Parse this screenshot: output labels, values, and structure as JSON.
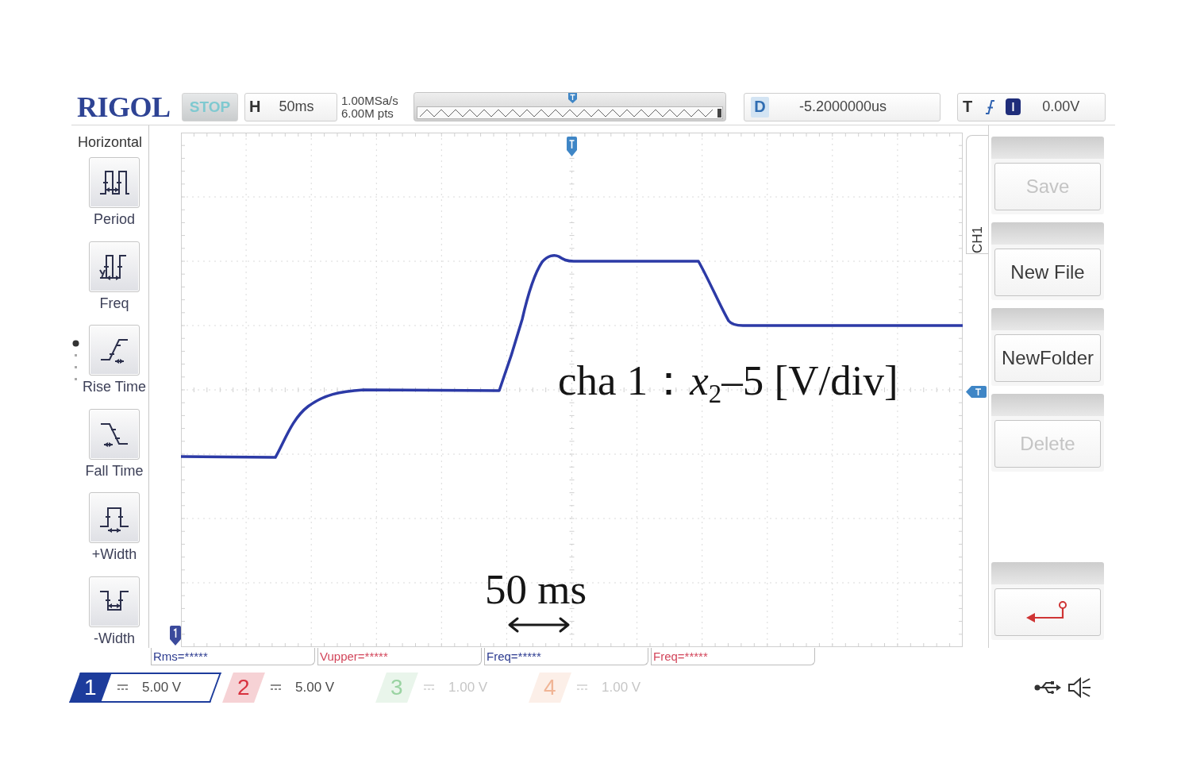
{
  "top_bar": {
    "logo": "RIGOL",
    "run_state": "STOP",
    "timebase": {
      "label": "H",
      "value": "50ms"
    },
    "acquisition": {
      "sample_rate": "1.00MSa/s",
      "memory_depth": "6.00M pts"
    },
    "delay": {
      "label": "D",
      "value": "-5.2000000us"
    },
    "trigger": {
      "label": "T",
      "level": "0.00V"
    }
  },
  "measure_panel": {
    "title": "Horizontal",
    "items": [
      {
        "kind": "period",
        "label": "Period"
      },
      {
        "kind": "freq",
        "label": "Freq"
      },
      {
        "kind": "rise",
        "label": "Rise Time"
      },
      {
        "kind": "fall",
        "label": "Fall Time"
      },
      {
        "kind": "pwidth",
        "label": "+Width"
      },
      {
        "kind": "nwidth",
        "label": "-Width"
      }
    ]
  },
  "display": {
    "annotations": [
      {
        "kind": "axis_note",
        "text": "cha 1：*x*$_{2}$–5 [V/div]"
      },
      {
        "kind": "time_scale",
        "text": "50 ms"
      }
    ]
  },
  "side_menu": {
    "tab": "CH1",
    "buttons": [
      {
        "kind": "text",
        "label": "Save",
        "disabled": true
      },
      {
        "kind": "text",
        "label": "New File",
        "disabled": false
      },
      {
        "kind": "text",
        "label": "NewFolder",
        "disabled": false
      },
      {
        "kind": "text",
        "label": "Delete",
        "disabled": true
      },
      {
        "kind": "back"
      }
    ]
  },
  "measurements": [
    {
      "text": "Rms=*****",
      "color": "#2b3a8f"
    },
    {
      "text": "Vupper=*****",
      "color": "#d2455a"
    },
    {
      "text": "Freq=*****",
      "color": "#2b3a8f"
    },
    {
      "text": "Freq=*****",
      "color": "#d2455a"
    }
  ],
  "channels": [
    {
      "number": "1",
      "scale": "5.00 V",
      "on": true,
      "selected": true,
      "color": "#1d3c9c"
    },
    {
      "number": "2",
      "scale": "5.00 V",
      "on": true,
      "selected": false,
      "color": "#d8323f"
    },
    {
      "number": "3",
      "scale": "1.00 V",
      "on": false,
      "selected": false,
      "color": "#9ad3a2"
    },
    {
      "number": "4",
      "scale": "1.00 V",
      "on": false,
      "selected": false,
      "color": "#f0b596"
    }
  ]
}
